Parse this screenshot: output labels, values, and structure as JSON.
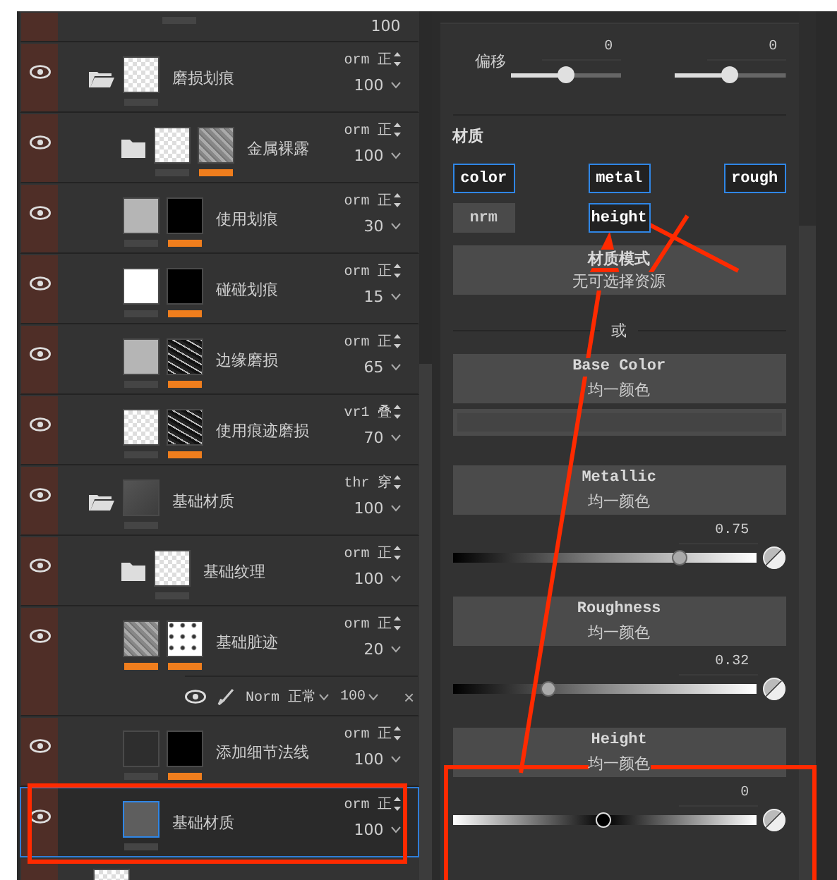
{
  "layers": [
    {
      "kind": "stub",
      "opacity": "100",
      "selected": false
    },
    {
      "kind": "folder",
      "expanded": true,
      "name": "磨损划痕",
      "blend": "orm 正",
      "opacity": "100",
      "selected": false,
      "thumbs": [
        {
          "kind": "checker",
          "color": "#454545"
        }
      ],
      "children": [
        {
          "kind": "folder",
          "expanded": false,
          "name": "金属裸露",
          "blend": "orm 正",
          "opacity": "100",
          "selected": false,
          "thumbs": [
            {
              "kind": "checker",
              "color": "#454545"
            },
            {
              "kind": "noise",
              "color": "#f07e1d"
            }
          ],
          "children": [
            {
              "kind": "fill",
              "name": "使用划痕",
              "blend": "orm 正",
              "opacity": "30",
              "selected": false,
              "thumbs": [
                {
                  "kind": "gray",
                  "color": "#454545"
                },
                {
                  "kind": "black",
                  "color": "#f07e1d"
                }
              ]
            },
            {
              "kind": "fill",
              "name": "碰碰划痕",
              "blend": "orm 正",
              "opacity": "15",
              "selected": false,
              "thumbs": [
                {
                  "kind": "white",
                  "color": "#454545"
                },
                {
                  "kind": "black",
                  "color": "#f07e1d"
                }
              ]
            },
            {
              "kind": "fill",
              "name": "边缘磨损",
              "blend": "orm 正",
              "opacity": "65",
              "selected": false,
              "thumbs": [
                {
                  "kind": "gray",
                  "color": "#454545"
                },
                {
                  "kind": "darknoise",
                  "color": "#f07e1d"
                }
              ]
            },
            {
              "kind": "fill",
              "name": "使用痕迹磨损",
              "blend": "vr1 叠",
              "opacity": "70",
              "selected": false,
              "thumbs": [
                {
                  "kind": "checker",
                  "color": "#454545"
                },
                {
                  "kind": "darknoise",
                  "color": "#f07e1d"
                }
              ]
            }
          ]
        }
      ]
    },
    {
      "kind": "folder",
      "expanded": true,
      "name": "基础材质",
      "blend": "thr 穿",
      "opacity": "100",
      "selected": false,
      "thumbs": [
        {
          "kind": "dark",
          "color": "#454545"
        }
      ],
      "children": [
        {
          "kind": "folder",
          "expanded": false,
          "name": "基础纹理",
          "blend": "orm 正",
          "opacity": "100",
          "selected": false,
          "thumbs": [
            {
              "kind": "checker",
              "color": "#454545"
            }
          ],
          "children": [
            {
              "kind": "fill",
              "name": "基础脏迹",
              "blend": "orm 正",
              "opacity": "20",
              "selected": false,
              "thumbs": [
                {
                  "kind": "noise",
                  "color": "#f07e1d"
                },
                {
                  "kind": "speckle",
                  "color": "#f07e1d"
                }
              ],
              "effects": [
                {
                  "blend": "Norm 正常",
                  "opacity": "100",
                  "remove": "×"
                }
              ]
            },
            {
              "kind": "fill",
              "name": "添加细节法线",
              "blend": "orm 正",
              "opacity": "100",
              "selected": false,
              "thumbs": [
                {
                  "kind": "empty",
                  "color": "#454545"
                },
                {
                  "kind": "black",
                  "color": "#f07e1d"
                }
              ]
            },
            {
              "kind": "fill",
              "name": "基础材质",
              "blend": "orm 正",
              "opacity": "100",
              "selected": true,
              "thumbs": [
                {
                  "kind": "mid",
                  "color": "#454545"
                }
              ]
            }
          ]
        },
        {
          "kind": "peek",
          "selected": false,
          "thumbs": [
            {
              "kind": "checker"
            }
          ]
        }
      ]
    }
  ],
  "properties": {
    "offset": {
      "label": "偏移",
      "sliders": [
        {
          "value": "0",
          "level": 0.5
        },
        {
          "value": "0",
          "level": 0.5
        }
      ]
    },
    "material": {
      "title": "材质",
      "channels": [
        {
          "label": "color",
          "selected": true
        },
        {
          "label": "metal",
          "selected": true
        },
        {
          "label": "rough",
          "selected": true
        },
        {
          "label": "nrm",
          "selected": false
        },
        {
          "label": "height",
          "selected": true
        }
      ]
    },
    "mode": {
      "title": "材质模式",
      "subtitle": "无可选择资源"
    },
    "or": "或",
    "inputs": [
      {
        "kind": "color",
        "title": "Base Color",
        "subtitle": "均一颜色"
      },
      {
        "kind": "scalar",
        "title": "Metallic",
        "subtitle": "均一颜色",
        "value": "0.75",
        "level": 0.75
      },
      {
        "kind": "scalar",
        "title": "Roughness",
        "subtitle": "均一颜色",
        "value": "0.32",
        "level": 0.32
      },
      {
        "kind": "height",
        "title": "Height",
        "subtitle": "均一颜色",
        "value": "0",
        "level": 0.5
      }
    ]
  }
}
